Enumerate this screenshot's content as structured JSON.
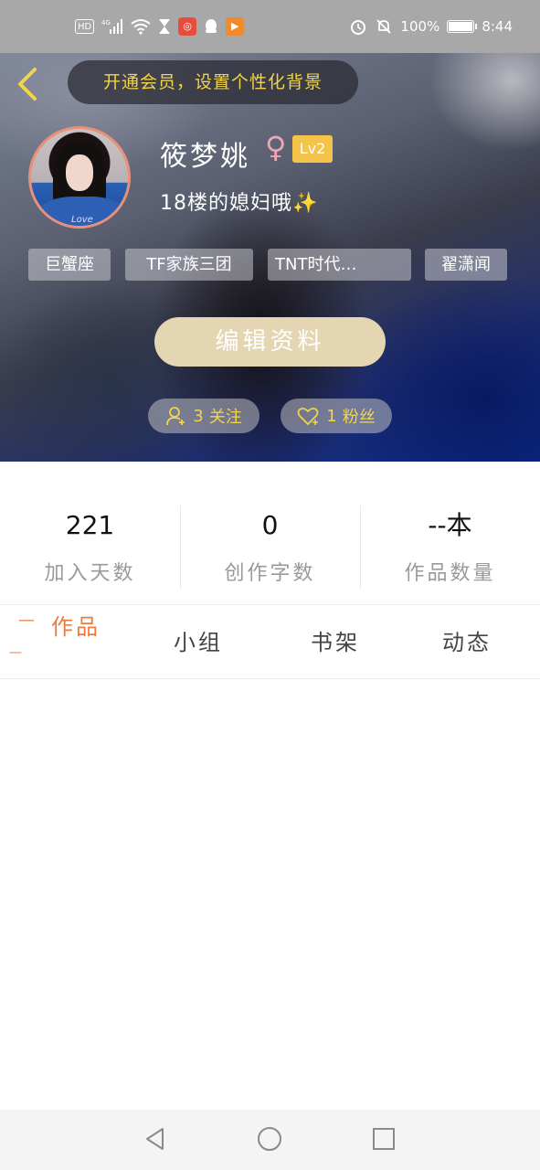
{
  "status_bar": {
    "left_icons": [
      "hd-icon",
      "signal-4g-icon",
      "wifi-icon",
      "hourglass-icon",
      "red-app-icon",
      "qq-icon",
      "video-app-icon"
    ],
    "hd_label": "HD",
    "network_label": "4G",
    "battery_percent": "100%",
    "battery_level": 1.0,
    "time": "8:44"
  },
  "header": {
    "vip_banner": "开通会员，设置个性化背景",
    "username": "筱梦姚",
    "gender_symbol": "♀",
    "level": "Lv2",
    "bio": "18楼的媳妇哦✨",
    "tags": [
      "巨蟹座",
      "TF家族三团",
      "TNT时代…",
      "翟潇闻"
    ],
    "edit_button": "编辑资料",
    "follow": {
      "count": "3",
      "label": "关注"
    },
    "fans": {
      "count": "1",
      "label": "粉丝"
    },
    "colors": {
      "vip_text": "#f2d44a",
      "level_badge": "#f3c34a",
      "edit_button_bg": "#e4d6b2"
    }
  },
  "stats": [
    {
      "value": "221",
      "label": "加入天数"
    },
    {
      "value": "0",
      "label": "创作字数"
    },
    {
      "value": "--本",
      "label": "作品数量"
    }
  ],
  "tabs": {
    "items": [
      "作品",
      "小组",
      "书架",
      "动态"
    ],
    "active": "作品",
    "accent_color": "#f07a3c"
  },
  "avatar": {
    "shirt_text": "Love"
  }
}
